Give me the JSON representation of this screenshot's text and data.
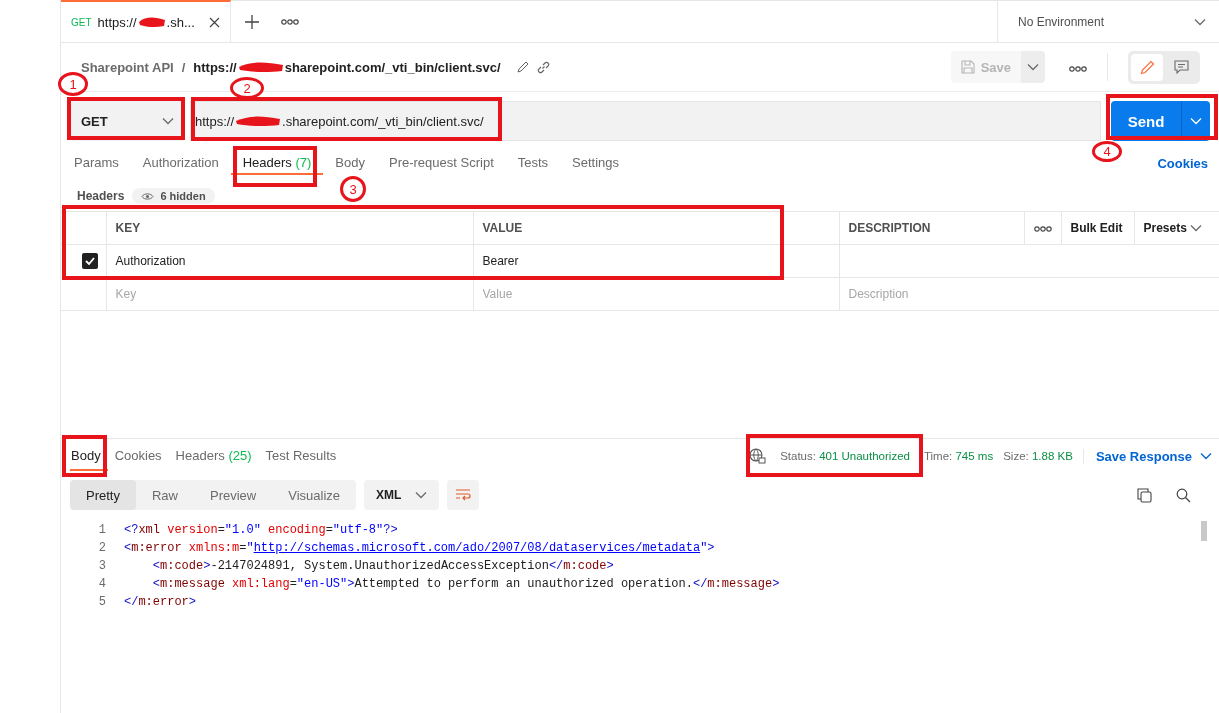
{
  "request_tab": {
    "method": "GET",
    "url_start": "https://",
    "url_end": ".sh...",
    "selected": true
  },
  "environment": "No Environment",
  "breadcrumb": {
    "collection": "Sharepoint API",
    "separator": "/",
    "url_start": "https://",
    "url_end": "sharepoint.com/_vti_bin/client.svc/"
  },
  "save_button": {
    "label": "Save",
    "disabled": true
  },
  "view_toggle": [
    {
      "kind": "edit",
      "selected": true
    },
    {
      "kind": "comments",
      "selected": false
    }
  ],
  "method": "GET",
  "url": {
    "start": "https://",
    "end": ".sharepoint.com/_vti_bin/client.svc/"
  },
  "send_button": "Send",
  "request_tabs": [
    {
      "label": "Params",
      "selected": false
    },
    {
      "label": "Authorization",
      "selected": false
    },
    {
      "label": "Headers",
      "count": "(7)",
      "selected": true
    },
    {
      "label": "Body",
      "selected": false
    },
    {
      "label": "Pre-request Script",
      "selected": false
    },
    {
      "label": "Tests",
      "selected": false
    },
    {
      "label": "Settings",
      "selected": false
    }
  ],
  "cookies_link": "Cookies",
  "headers_section": {
    "title": "Headers",
    "hidden": "6 hidden"
  },
  "headers_table": {
    "columns": [
      "KEY",
      "VALUE",
      "DESCRIPTION"
    ],
    "bulk_edit": "Bulk Edit",
    "presets": "Presets",
    "rows": [
      {
        "key": "Authorization",
        "value": "Bearer",
        "checked": true
      }
    ],
    "placeholder_row": [
      {
        "placeholder": "Key"
      },
      {
        "placeholder": "Value"
      },
      {
        "placeholder": "Description"
      }
    ]
  },
  "response_tabs": [
    {
      "label": "Body",
      "selected": true
    },
    {
      "label": "Cookies",
      "selected": false
    },
    {
      "label": "Headers",
      "count": "(25)",
      "selected": false
    },
    {
      "label": "Test Results",
      "selected": false
    }
  ],
  "response_meta": {
    "status_label": "Status:",
    "status": "401 Unauthorized",
    "time_label": "Time:",
    "time": "745 ms",
    "size_label": "Size:",
    "size": "1.88 KB"
  },
  "save_response": "Save Response",
  "view_modes": [
    {
      "label": "Pretty",
      "selected": true
    },
    {
      "label": "Raw",
      "selected": false
    },
    {
      "label": "Preview",
      "selected": false
    },
    {
      "label": "Visualize",
      "selected": false
    }
  ],
  "format": "XML",
  "code_lines": [
    {
      "number": "1",
      "tokens": [
        {
          "kind": "bracket",
          "text": "<?"
        },
        {
          "kind": "tag",
          "text": "xml"
        },
        {
          "kind": "attr",
          "text": " version"
        },
        {
          "kind": "text",
          "text": "="
        },
        {
          "kind": "string",
          "text": "\"1.0\""
        },
        {
          "kind": "attr",
          "text": " encoding"
        },
        {
          "kind": "text",
          "text": "="
        },
        {
          "kind": "string",
          "text": "\"utf-8\""
        },
        {
          "kind": "bracket",
          "text": "?>"
        }
      ]
    },
    {
      "number": "2",
      "tokens": [
        {
          "kind": "bracket",
          "text": "<"
        },
        {
          "kind": "tag",
          "text": "m:error"
        },
        {
          "kind": "attr",
          "text": " xmlns:m"
        },
        {
          "kind": "text",
          "text": "="
        },
        {
          "kind": "string",
          "text": "\""
        },
        {
          "kind": "link",
          "text": "http://schemas.microsoft.com/ado/2007/08/dataservices/metadata"
        },
        {
          "kind": "string",
          "text": "\""
        },
        {
          "kind": "bracket",
          "text": ">"
        }
      ]
    },
    {
      "number": "3",
      "tokens": [
        {
          "kind": "bracket",
          "text": "    <"
        },
        {
          "kind": "tag",
          "text": "m:code"
        },
        {
          "kind": "bracket",
          "text": ">"
        },
        {
          "kind": "text",
          "text": "-2147024891, System.UnauthorizedAccessException"
        },
        {
          "kind": "bracket",
          "text": "</"
        },
        {
          "kind": "tag",
          "text": "m:code"
        },
        {
          "kind": "bracket",
          "text": ">"
        }
      ]
    },
    {
      "number": "4",
      "tokens": [
        {
          "kind": "bracket",
          "text": "    <"
        },
        {
          "kind": "tag",
          "text": "m:message"
        },
        {
          "kind": "attr",
          "text": " xml:lang"
        },
        {
          "kind": "text",
          "text": "="
        },
        {
          "kind": "string",
          "text": "\"en-US\""
        },
        {
          "kind": "bracket",
          "text": ">"
        },
        {
          "kind": "text",
          "text": "Attempted to perform an unauthorized operation."
        },
        {
          "kind": "bracket",
          "text": "</"
        },
        {
          "kind": "tag",
          "text": "m:message"
        },
        {
          "kind": "bracket",
          "text": ">"
        }
      ]
    },
    {
      "number": "5",
      "tokens": [
        {
          "kind": "bracket",
          "text": "</"
        },
        {
          "kind": "tag",
          "text": "m:error"
        },
        {
          "kind": "bracket",
          "text": ">"
        }
      ]
    }
  ],
  "annotations": [
    {
      "label": "1"
    },
    {
      "label": "2"
    },
    {
      "label": "3"
    },
    {
      "label": "4"
    }
  ]
}
